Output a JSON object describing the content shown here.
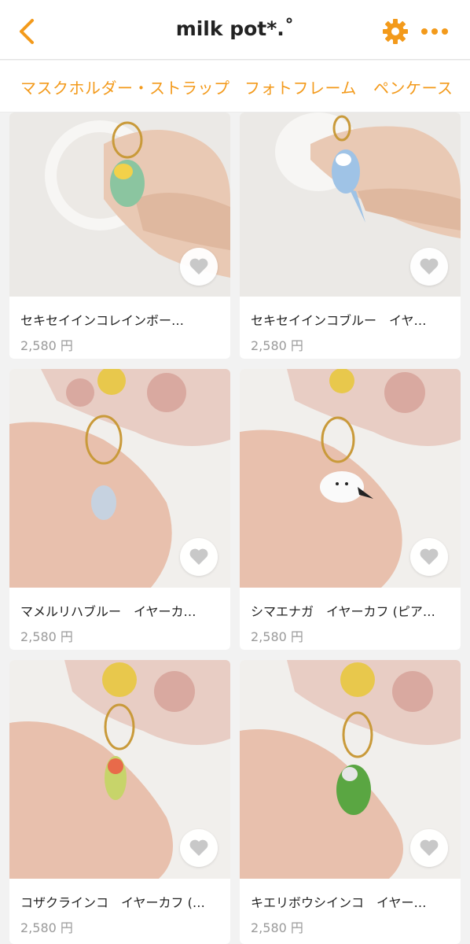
{
  "header": {
    "title": "milk pot*.˚",
    "back_icon": "chevron-left-icon",
    "settings_icon": "gear-icon",
    "more_icon": "more-dots-icon",
    "accent_color": "#f39a1b"
  },
  "tabs": [
    {
      "label": "マスクホルダー・ストラップ"
    },
    {
      "label": "フォトフレーム"
    },
    {
      "label": "ペンケース"
    }
  ],
  "products": [
    {
      "name": "セキセイインコレインボー…",
      "price": "2,580 円",
      "bird": "rainbow budgie"
    },
    {
      "name": "セキセイインコブルー　イヤ…",
      "price": "2,580 円",
      "bird": "blue budgie"
    },
    {
      "name": "マメルリハブルー　イヤーカ…",
      "price": "2,580 円",
      "bird": "blue parrotlet"
    },
    {
      "name": "シマエナガ　イヤーカフ (ピア…",
      "price": "2,580 円",
      "bird": "long-tailed tit"
    },
    {
      "name": "コザクラインコ　イヤーカフ (…",
      "price": "2,580 円",
      "bird": "lovebird"
    },
    {
      "name": "キエリボウシインコ　イヤー…",
      "price": "2,580 円",
      "bird": "yellow-naped amazon"
    }
  ]
}
